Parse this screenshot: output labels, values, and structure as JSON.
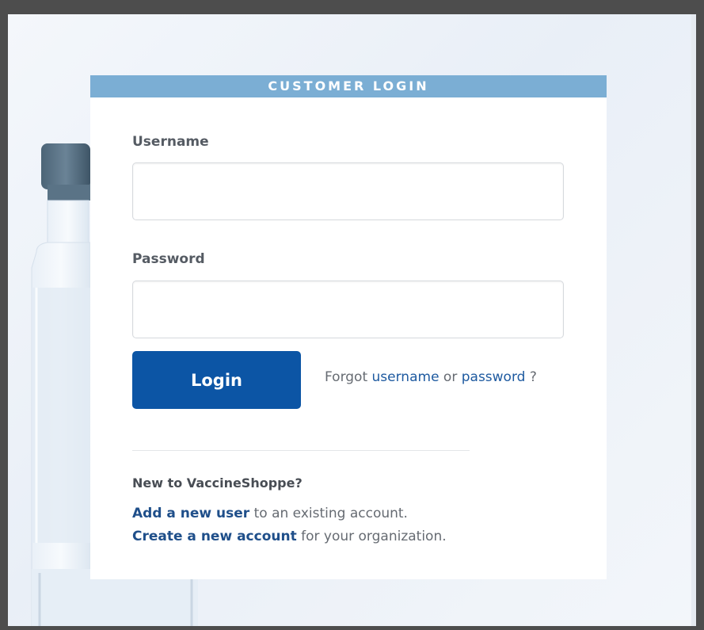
{
  "login_card": {
    "header": "CUSTOMER LOGIN",
    "username_label": "Username",
    "username_value": "",
    "password_label": "Password",
    "password_value": "",
    "login_button": "Login",
    "forgot_prefix": "Forgot ",
    "forgot_username_link": "username",
    "forgot_or": " or ",
    "forgot_password_link": "password",
    "forgot_suffix": " ?"
  },
  "signup": {
    "title": "New to VaccineShoppe?",
    "add_user_link": "Add a new user",
    "add_user_suffix": " to an existing account.",
    "create_account_link": "Create a new account",
    "create_account_suffix": " for your organization."
  },
  "colors": {
    "header_bg": "#7baed4",
    "button_bg": "#0c55a5",
    "link": "#1f4f8a"
  }
}
